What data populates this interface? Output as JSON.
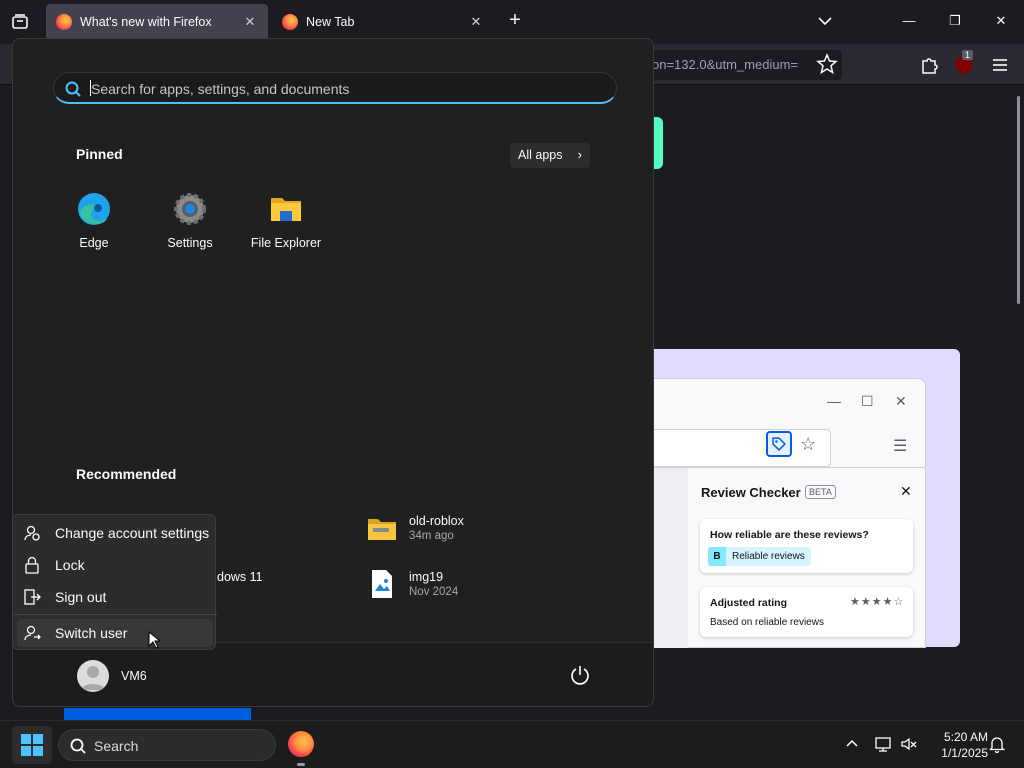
{
  "browser": {
    "tabs": [
      {
        "title": "What's new with Firefox",
        "active": true
      },
      {
        "title": "New Tab",
        "active": false
      }
    ],
    "new_tab_label": "+",
    "url_fragment": "on=132.0&utm_medium=",
    "ublock_count": "1"
  },
  "page": {
    "review_checker": {
      "title": "Review Checker",
      "beta": "BETA",
      "question": "How reliable are these reviews?",
      "grade": "B",
      "grade_label": "Reliable reviews",
      "adjusted_title": "Adjusted rating",
      "stars": "★★★★☆",
      "adjusted_sub": "Based on reliable reviews"
    }
  },
  "start_menu": {
    "search_placeholder": "Search for apps, settings, and documents",
    "pinned_heading": "Pinned",
    "all_apps_label": "All apps",
    "pinned": [
      {
        "label": "Edge",
        "icon": "edge-icon"
      },
      {
        "label": "Settings",
        "icon": "settings-gear-icon"
      },
      {
        "label": "File Explorer",
        "icon": "file-explorer-icon"
      }
    ],
    "recommended_heading": "Recommended",
    "recommended": [
      {
        "title": "dows 11",
        "sub": ""
      },
      {
        "title": "old-roblox",
        "sub": "34m ago",
        "icon": "folder-zip-icon"
      },
      {
        "title": "img19",
        "sub": "Nov 2024",
        "icon": "image-file-icon"
      }
    ],
    "user_name": "VM6",
    "account_menu": [
      {
        "label": "Change account settings",
        "icon": "account-settings-icon"
      },
      {
        "label": "Lock",
        "icon": "lock-icon"
      },
      {
        "label": "Sign out",
        "icon": "sign-out-icon"
      },
      {
        "label": "Switch user",
        "icon": "switch-user-icon"
      }
    ]
  },
  "taskbar": {
    "search_label": "Search",
    "time": "5:20 AM",
    "date": "1/1/2025"
  },
  "colors": {
    "accent": "#4cc2ff",
    "firefox_blue": "#0060df",
    "promo_bg": "#e0dbff"
  }
}
